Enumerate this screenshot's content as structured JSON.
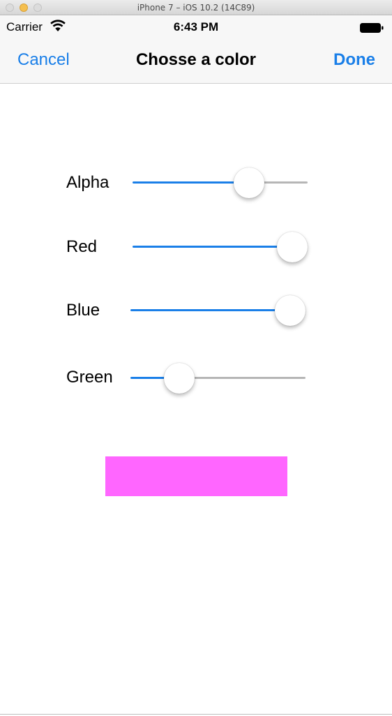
{
  "window": {
    "title": "iPhone 7 – iOS 10.2 (14C89)"
  },
  "status_bar": {
    "carrier": "Carrier",
    "time": "6:43 PM",
    "wifi_icon": "wifi-icon",
    "battery_icon": "battery-icon"
  },
  "nav": {
    "cancel_label": "Cancel",
    "title": "Chosse a color",
    "done_label": "Done"
  },
  "sliders": [
    {
      "label": "Alpha",
      "value": 0.7
    },
    {
      "label": "Red",
      "value": 1.0
    },
    {
      "label": "Blue",
      "value": 1.0
    },
    {
      "label": "Green",
      "value": 0.23
    }
  ],
  "preview": {
    "color": "#ff66ff"
  },
  "colors": {
    "accent": "#1a7fe8",
    "track": "#b6b6b6"
  }
}
